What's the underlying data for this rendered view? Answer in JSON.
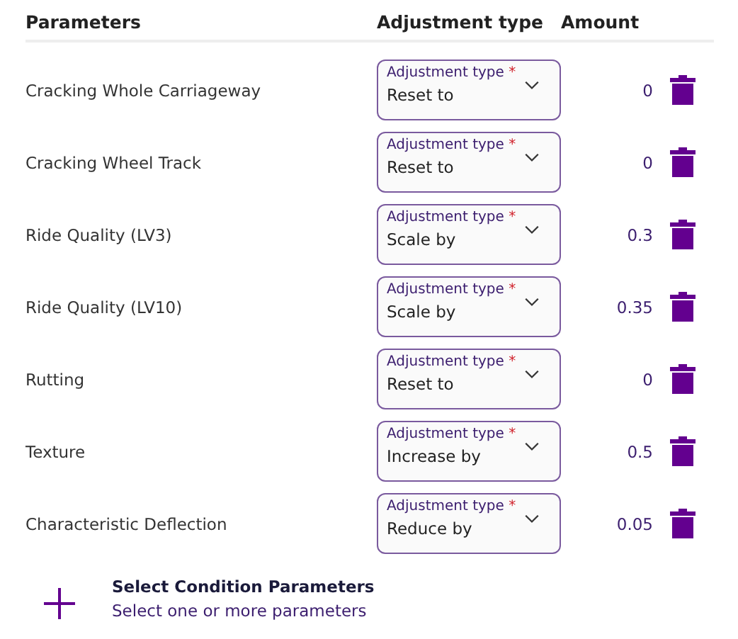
{
  "columns": [
    "Parameters",
    "Adjustment type",
    "Amount"
  ],
  "rows": [
    {
      "name": "Cracking Whole Carriageway",
      "select_label": "Adjustment type",
      "required_mark": "*",
      "value": "Reset to",
      "amount": "0"
    },
    {
      "name": "Cracking Wheel Track",
      "select_label": "Adjustment type",
      "required_mark": "*",
      "value": "Reset to",
      "amount": "0"
    },
    {
      "name": "Ride Quality (LV3)",
      "select_label": "Adjustment type",
      "required_mark": "*",
      "value": "Scale by",
      "amount": "0.3"
    },
    {
      "name": "Ride Quality (LV10)",
      "select_label": "Adjustment type",
      "required_mark": "*",
      "value": "Scale by",
      "amount": "0.35"
    },
    {
      "name": "Rutting",
      "select_label": "Adjustment type",
      "required_mark": "*",
      "value": "Reset to",
      "amount": "0"
    },
    {
      "name": "Texture",
      "select_label": "Adjustment type",
      "required_mark": "*",
      "value": "Increase by",
      "amount": "0.5"
    },
    {
      "name": "Characteristic Deflection",
      "select_label": "Adjustment type",
      "required_mark": "*",
      "value": "Reduce by",
      "amount": "0.05"
    }
  ],
  "add": {
    "title": "Select Condition Parameters",
    "subtitle": "Select one or more parameters"
  }
}
